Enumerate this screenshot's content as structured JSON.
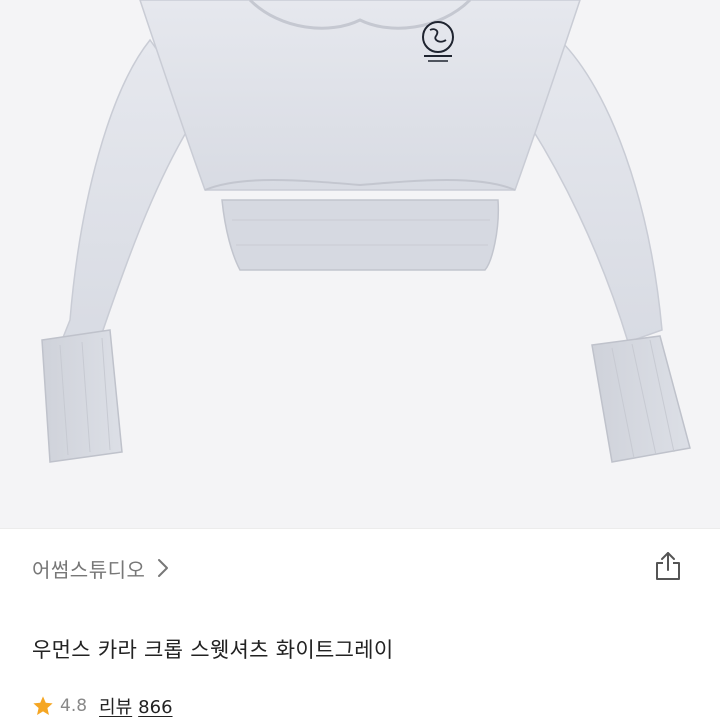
{
  "product": {
    "brand": "어썸스튜디오",
    "title": "우먼스 카라 크롭 스웻셔츠 화이트그레이",
    "rating": "4.8",
    "review_label": "리뷰",
    "review_count": "866"
  },
  "icons": {
    "brand_chevron": "chevron-right-icon",
    "share": "share-icon",
    "rating_star": "star-icon"
  },
  "colors": {
    "star": "#f5a623",
    "brand_text": "#777777",
    "title_text": "#222222",
    "sweatshirt": "#dfe1e8"
  }
}
